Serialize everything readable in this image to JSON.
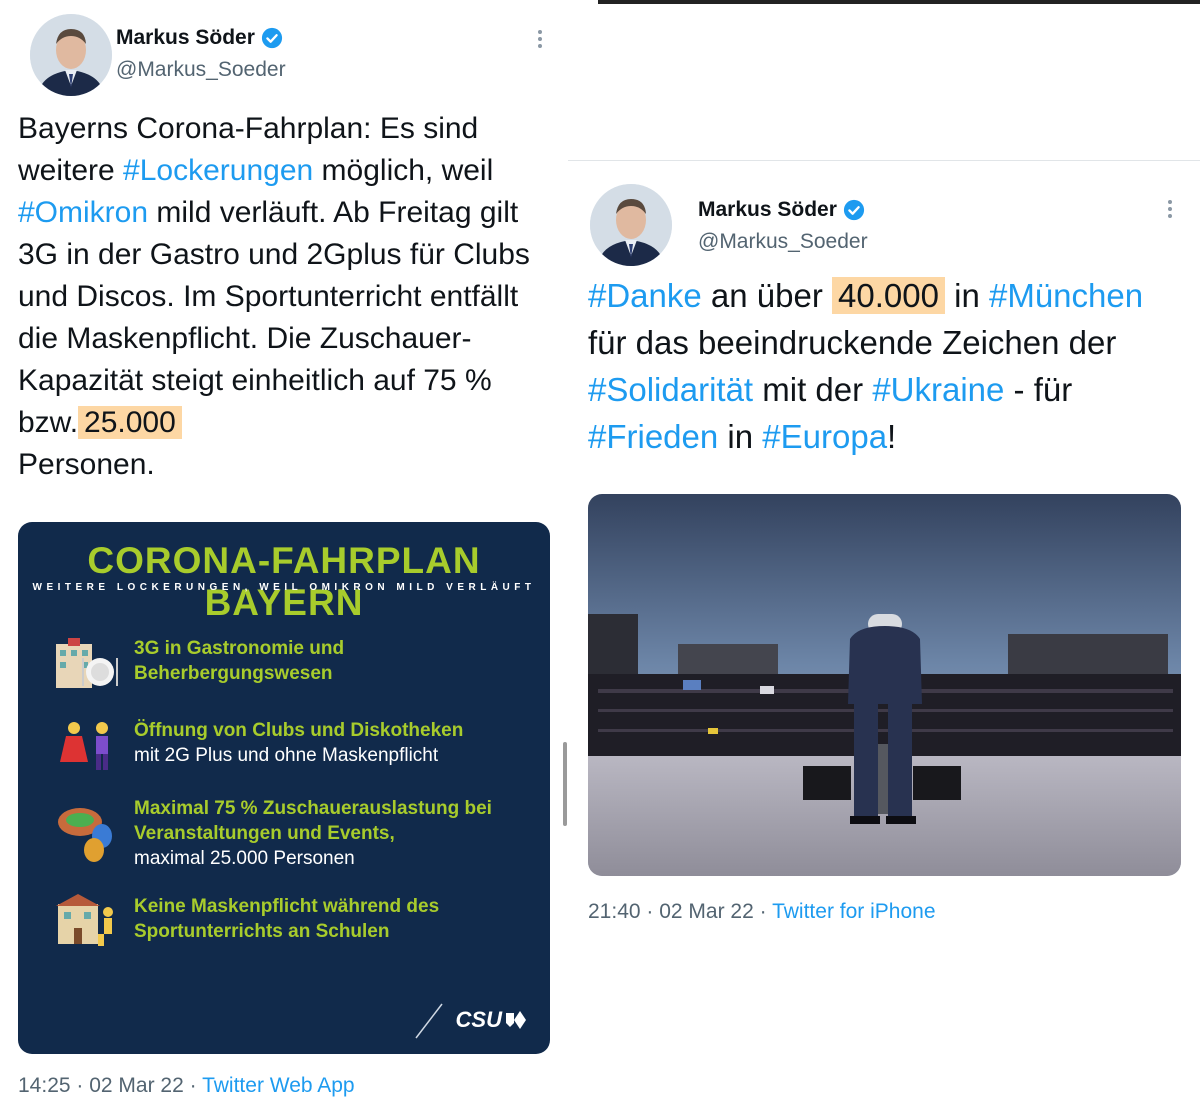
{
  "left_tweet": {
    "author_name": "Markus Söder",
    "handle": "@Markus_Soeder",
    "text": {
      "p1": "Bayerns Corona-Fahrplan: Es sind weitere ",
      "t1": "#Lockerungen",
      "p2": " möglich, weil ",
      "t2": "#Omikron",
      "p3": " mild verläuft. Ab Freitag gilt 3G in der Gastro und 2Gplus für Clubs und Discos. Im Sportunterricht entfällt die Maskenpflicht. Die Zuschauer-Kapazität steigt einheitlich auf 75 % bzw.",
      "highlight": "25.000",
      "p4": "Personen."
    },
    "card": {
      "title": "CORONA-FAHRPLAN BAYERN",
      "subtitle": "WEITERE LOCKERUNGEN, WEIL OMIKRON MILD VERLÄUFT",
      "items": [
        {
          "green": "3G in Gastronomie und Beherbergungswesen",
          "white": "",
          "icon": "hotel-dining-icon"
        },
        {
          "green": "Öffnung von Clubs und Diskotheken",
          "white": "mit 2G Plus und ohne Maskenpflicht",
          "icon": "dancers-icon"
        },
        {
          "green": "Maximal 75 % Zuschauerauslastung bei Veranstaltungen und Events,",
          "white": "maximal 25.000 Personen",
          "icon": "stadium-theater-icon"
        },
        {
          "green": "Keine Maskenpflicht während des Sportunterrichts an Schulen",
          "white": "",
          "icon": "school-icon"
        }
      ],
      "logo": "CSU"
    },
    "time": "14:25",
    "date": "02 Mar 22",
    "source": "Twitter Web App"
  },
  "right_tweet": {
    "author_name": "Markus Söder",
    "handle": "@Markus_Soeder",
    "text": {
      "t1": "#Danke",
      "p1": " an über ",
      "highlight": "40.000",
      "p2": " in ",
      "t2": "#München",
      "p3": " für das beeindruckende Zeichen der ",
      "t3": "#Solidarität",
      "p4": " mit der ",
      "t4": "#Ukraine",
      "p5": " - für ",
      "t5": "#Frieden",
      "p6": " in ",
      "t6": "#Europa",
      "p7": "!"
    },
    "time": "21:40",
    "date": "02 Mar 22",
    "source": "Twitter for iPhone"
  },
  "colors": {
    "link": "#1d9bf0",
    "highlight": "#fdd7a4",
    "card_bg": "#112a4b",
    "card_green": "#a8cc2c",
    "muted": "#536471"
  }
}
